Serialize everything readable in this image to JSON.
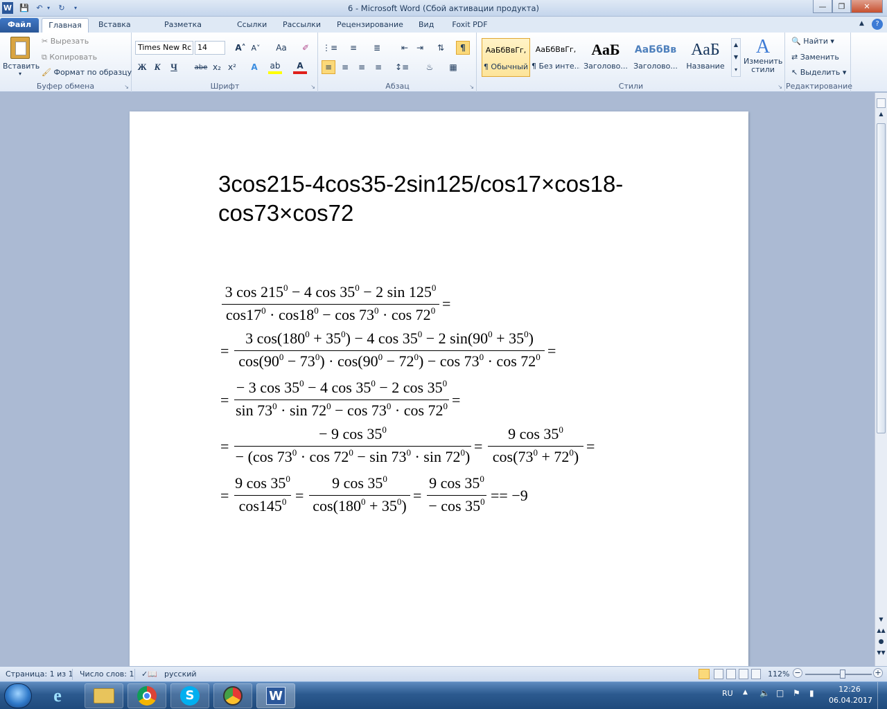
{
  "window": {
    "title": "6 - Microsoft Word (Сбой активации продукта)",
    "app_icon": "W"
  },
  "quick_access": [
    "save-icon",
    "undo-icon",
    "redo-icon",
    "customize-icon"
  ],
  "tabs": [
    "Файл",
    "Главная",
    "Вставка",
    "Разметка страницы",
    "Ссылки",
    "Рассылки",
    "Рецензирование",
    "Вид",
    "Foxit PDF"
  ],
  "ribbon": {
    "clipboard": {
      "label": "Буфер обмена",
      "paste": "Вставить",
      "cut": "Вырезать",
      "copy": "Копировать",
      "format_painter": "Формат по образцу"
    },
    "font": {
      "label": "Шрифт",
      "font_name": "Times New Rc",
      "font_size": "14",
      "grow": "A˄",
      "shrink": "A˅",
      "case": "Aa",
      "bold": "Ж",
      "italic": "К",
      "underline": "Ч",
      "strike": "abe",
      "subscript": "x₂",
      "superscript": "x²"
    },
    "paragraph": {
      "label": "Абзац"
    },
    "styles": {
      "label": "Стили",
      "items": [
        {
          "preview": "АаБбВвГг,",
          "name": "¶ Обычный"
        },
        {
          "preview": "АаБбВвГг,",
          "name": "¶ Без инте..."
        },
        {
          "preview": "АаБ",
          "name": "Заголово..."
        },
        {
          "preview": "АаБбВв",
          "name": "Заголово..."
        },
        {
          "preview": "АаБ",
          "name": "Название"
        }
      ],
      "change": "Изменить стили"
    },
    "editing": {
      "label": "Редактирование",
      "find": "Найти",
      "replace": "Заменить",
      "select": "Выделить"
    }
  },
  "document": {
    "heading_line1": "3cos215-4cos35-2sin125/cos17×cos18-",
    "heading_line2": "cos73×cos72",
    "math": {
      "l1_num": "3 cos 215⁰ − 4 cos 35⁰ − 2 sin 125⁰",
      "l1_den": "cos17⁰ · cos18⁰ − cos 73⁰ · cos 72⁰",
      "l2_num": "3 cos(180⁰ + 35⁰) − 4 cos 35⁰ − 2 sin(90⁰ + 35⁰)",
      "l2_den": "cos(90⁰ − 73⁰) · cos(90⁰ − 72⁰) − cos 73⁰ · cos 72⁰",
      "l3_num": "− 3 cos 35⁰ − 4 cos 35⁰ − 2 cos 35⁰",
      "l3_den": "sin 73⁰ · sin 72⁰ − cos 73⁰ · cos 72⁰",
      "l4a_num": "− 9 cos 35⁰",
      "l4a_den": "− (cos 73⁰ · cos 72⁰ − sin 73⁰ · sin 72⁰)",
      "l4b_num": "9 cos 35⁰",
      "l4b_den": "cos(73⁰ + 72⁰)",
      "l5a_num": "9 cos 35⁰",
      "l5a_den": "cos145⁰",
      "l5b_num": "9 cos 35⁰",
      "l5b_den": "cos(180⁰ + 35⁰)",
      "l5c_num": "9 cos 35⁰",
      "l5c_den": "− cos 35⁰",
      "result": "== −9",
      "eq": "=",
      "eq2": "="
    }
  },
  "statusbar": {
    "page": "Страница: 1 из 1",
    "words": "Число слов: 1",
    "language": "русский",
    "zoom": "112%",
    "zoom_level": 0.56
  },
  "taskbar": {
    "apps": [
      "ie-icon",
      "explorer-icon",
      "chrome-icon",
      "skype-icon",
      "app-icon",
      "word-icon"
    ],
    "lang": "RU",
    "time": "12:26",
    "date": "06.04.2017"
  },
  "colors": {
    "accent": "#2b579a",
    "file_tab": "#2b5797",
    "workspace": "#abbad3",
    "taskbar": "#2c5a8f"
  }
}
